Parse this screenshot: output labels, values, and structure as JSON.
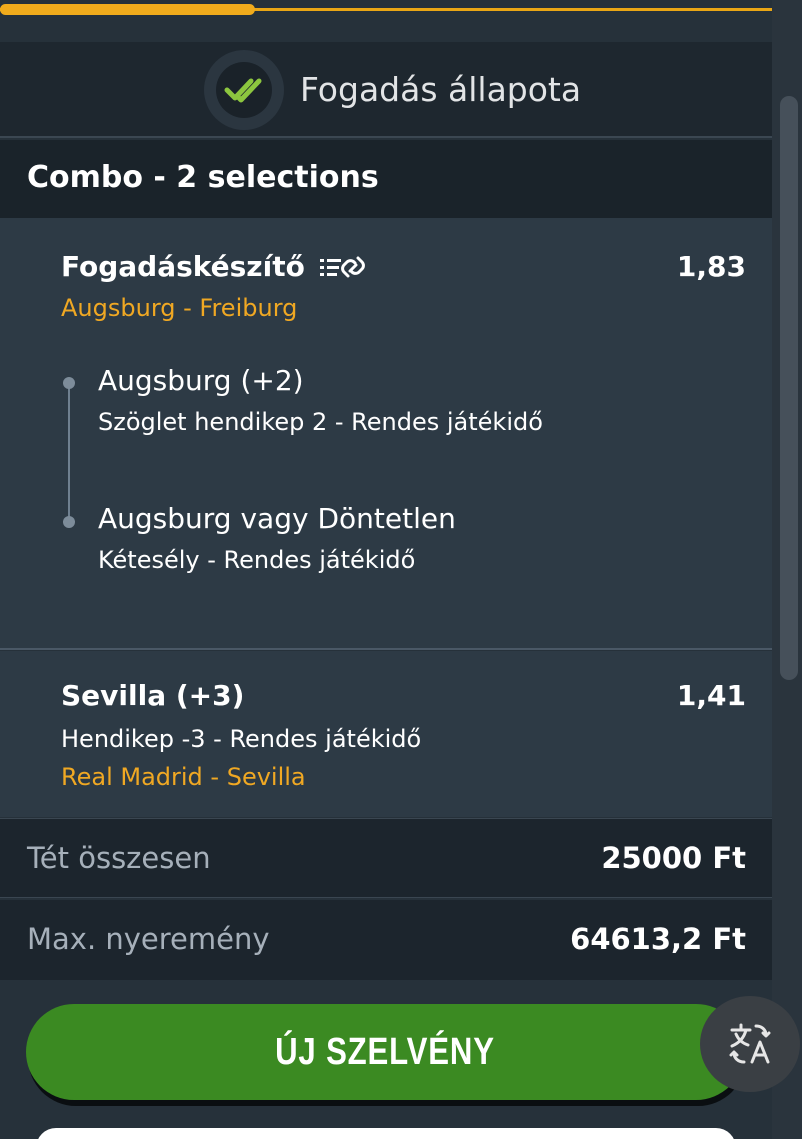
{
  "progress": {
    "fraction": 0.33
  },
  "header": {
    "title": "Fogadás állapota",
    "icon": "double-check-icon"
  },
  "combo": {
    "title": "Combo - 2 selections"
  },
  "selections": [
    {
      "title": "Fogadáskészítő",
      "odds": "1,83",
      "match": "Augsburg - Freiburg",
      "icon": "bet-builder-link-icon",
      "legs": [
        {
          "title": "Augsburg (+2)",
          "desc": "Szöglet hendikep 2 - Rendes játékidő"
        },
        {
          "title": "Augsburg vagy Döntetlen",
          "desc": "Kétesély - Rendes játékidő"
        }
      ]
    },
    {
      "title": "Sevilla (+3)",
      "odds": "1,41",
      "desc": "Hendikep -3 - Rendes játékidő",
      "match": "Real Madrid - Sevilla"
    }
  ],
  "totals": {
    "stake_label": "Tét összesen",
    "stake_value": "25000 Ft",
    "max_win_label": "Max. nyeremény",
    "max_win_value": "64613,2 Ft"
  },
  "actions": {
    "new_slip_label": "ÚJ SZELVÉNY",
    "translate_icon": "translate-icon"
  },
  "colors": {
    "accent": "#f0a823",
    "button_green": "#3b8a22",
    "check_green": "#8cc63f"
  }
}
